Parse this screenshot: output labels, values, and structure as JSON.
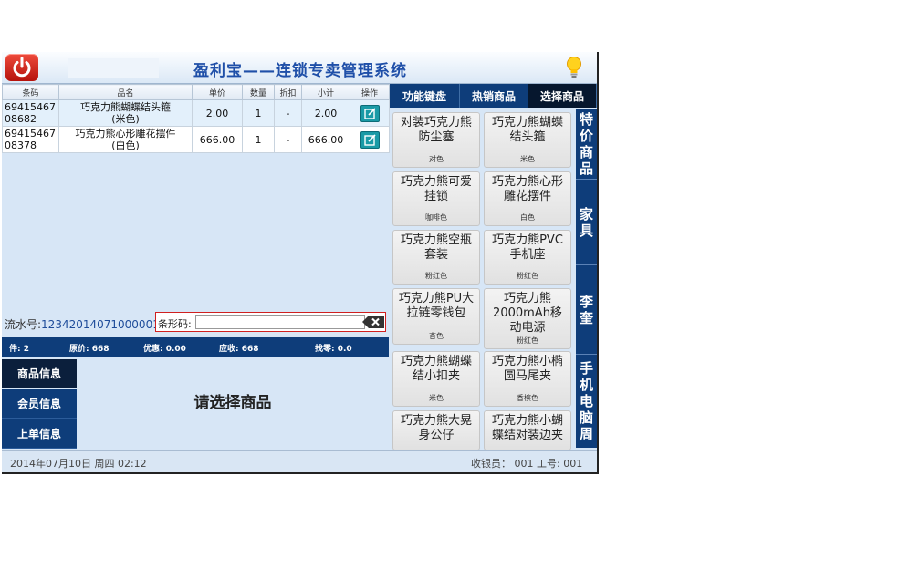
{
  "header": {
    "title": "盈利宝——连锁专卖管理系统"
  },
  "cart": {
    "columns": [
      "条码",
      "品名",
      "单价",
      "数量",
      "折扣",
      "小计",
      "操作"
    ],
    "rows": [
      {
        "code": "6941546708682",
        "name": "巧克力熊蝴蝶结头箍\n(米色)",
        "price": "2.00",
        "qty": "1",
        "discount": "-",
        "subtotal": "2.00"
      },
      {
        "code": "6941546708378",
        "name": "巧克力熊心形雕花摆件\n(白色)",
        "price": "666.00",
        "qty": "1",
        "discount": "-",
        "subtotal": "666.00"
      }
    ]
  },
  "serial": {
    "label": "流水号:",
    "value": "12342014071000001"
  },
  "barcode": {
    "label": "条形码:",
    "value": ""
  },
  "totals": {
    "count": "件: 2",
    "original": "原价: 668",
    "discount": "优惠: 0.00",
    "receivable": "应收: 668",
    "change": "找零: 0.0"
  },
  "info_tabs": [
    "商品信息",
    "会员信息",
    "上单信息"
  ],
  "prompt": "请选择商品",
  "right_tabs": [
    "功能键盘",
    "热销商品",
    "选择商品"
  ],
  "products": [
    {
      "name": "对装巧克力熊防尘塞",
      "color": "对色"
    },
    {
      "name": "巧克力熊蝴蝶结头箍",
      "color": "米色"
    },
    {
      "name": "巧克力熊可爱挂锁",
      "color": "咖啡色"
    },
    {
      "name": "巧克力熊心形雕花摆件",
      "color": "白色"
    },
    {
      "name": "巧克力熊空瓶套装",
      "color": "粉红色"
    },
    {
      "name": "巧克力熊PVC手机座",
      "color": "粉红色"
    },
    {
      "name": "巧克力熊PU大拉链零钱包",
      "color": "杏色"
    },
    {
      "name": "巧克力熊2000mAh移动电源",
      "color": "粉红色"
    },
    {
      "name": "巧克力熊蝴蝶结小扣夹",
      "color": "米色"
    },
    {
      "name": "巧克力熊小椭圆马尾夹",
      "color": "香槟色"
    },
    {
      "name": "巧克力熊大晃身公仔",
      "color": ""
    },
    {
      "name": "巧克力熊小蝴蝶结对装边夹",
      "color": ""
    }
  ],
  "categories": [
    "特价商品",
    "家具",
    "李奎",
    "手机电脑周"
  ],
  "footer": {
    "datetime": "2014年07月10日  周四 02:12",
    "cashier": "收银员： 001   工号: 001"
  },
  "colors": {
    "header_title": "#1f4fa8",
    "dark_navy": "#0e3d7a",
    "active_tab": "#06172e",
    "power": "#d0261c"
  }
}
